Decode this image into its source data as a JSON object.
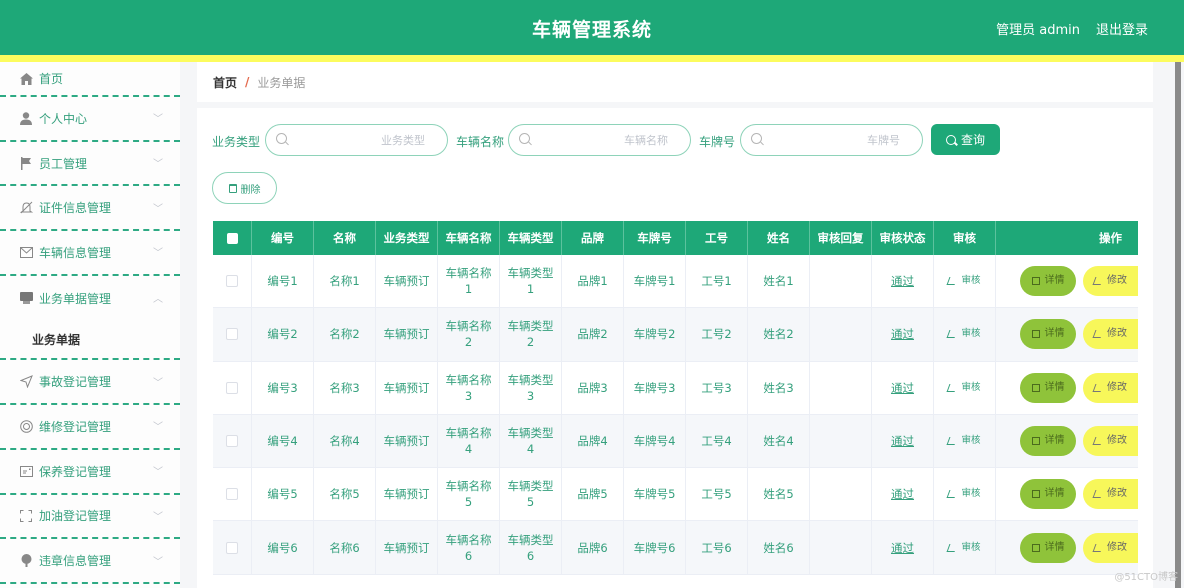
{
  "header": {
    "title": "车辆管理系统",
    "user": "管理员 admin",
    "logout": "退出登录"
  },
  "colors": {
    "primary": "#1ea878",
    "accent_stripe": "#fcfc5e",
    "detail_button": "#8fc33a",
    "edit_button": "#f7f75a",
    "text_green": "#35a07d"
  },
  "sidebar": {
    "items": [
      {
        "label": "首页",
        "icon": "home-icon"
      },
      {
        "label": "个人中心",
        "icon": "user-icon"
      },
      {
        "label": "员工管理",
        "icon": "flag-icon"
      },
      {
        "label": "证件信息管理",
        "icon": "bell-off-icon"
      },
      {
        "label": "车辆信息管理",
        "icon": "mail-icon"
      },
      {
        "label": "业务单据管理",
        "icon": "document-icon",
        "expanded": true,
        "children": [
          {
            "label": "业务单据"
          }
        ]
      },
      {
        "label": "事故登记管理",
        "icon": "navigation-icon"
      },
      {
        "label": "维修登记管理",
        "icon": "lifebuoy-icon"
      },
      {
        "label": "保养登记管理",
        "icon": "card-icon"
      },
      {
        "label": "加油登记管理",
        "icon": "fullscreen-icon"
      },
      {
        "label": "违章信息管理",
        "icon": "pin-icon"
      }
    ]
  },
  "breadcrumb": {
    "home": "首页",
    "separator": "/",
    "current": "业务单据"
  },
  "search": {
    "fields": [
      {
        "label": "业务类型",
        "placeholder": "业务类型",
        "value": ""
      },
      {
        "label": "车辆名称",
        "placeholder": "车辆名称",
        "value": ""
      },
      {
        "label": "车牌号",
        "placeholder": "车牌号",
        "value": ""
      }
    ],
    "query_button": "查询"
  },
  "actions": {
    "delete_button": "删除"
  },
  "table": {
    "columns": [
      "编号",
      "名称",
      "业务类型",
      "车辆名称",
      "车辆类型",
      "品牌",
      "车牌号",
      "工号",
      "姓名",
      "审核回复",
      "审核状态",
      "审核",
      "操作"
    ],
    "audit_label": "审核",
    "detail_label": "详情",
    "edit_label": "修改",
    "rows": [
      {
        "id": "编号1",
        "name": "名称1",
        "biz_type": "车辆预订",
        "car_name": "车辆名称\n1",
        "car_type": "车辆类型\n1",
        "brand": "品牌1",
        "plate": "车牌号1",
        "emp_no": "工号1",
        "person": "姓名1",
        "reply": "",
        "status": "通过"
      },
      {
        "id": "编号2",
        "name": "名称2",
        "biz_type": "车辆预订",
        "car_name": "车辆名称\n2",
        "car_type": "车辆类型\n2",
        "brand": "品牌2",
        "plate": "车牌号2",
        "emp_no": "工号2",
        "person": "姓名2",
        "reply": "",
        "status": "通过"
      },
      {
        "id": "编号3",
        "name": "名称3",
        "biz_type": "车辆预订",
        "car_name": "车辆名称\n3",
        "car_type": "车辆类型\n3",
        "brand": "品牌3",
        "plate": "车牌号3",
        "emp_no": "工号3",
        "person": "姓名3",
        "reply": "",
        "status": "通过"
      },
      {
        "id": "编号4",
        "name": "名称4",
        "biz_type": "车辆预订",
        "car_name": "车辆名称\n4",
        "car_type": "车辆类型\n4",
        "brand": "品牌4",
        "plate": "车牌号4",
        "emp_no": "工号4",
        "person": "姓名4",
        "reply": "",
        "status": "通过"
      },
      {
        "id": "编号5",
        "name": "名称5",
        "biz_type": "车辆预订",
        "car_name": "车辆名称\n5",
        "car_type": "车辆类型\n5",
        "brand": "品牌5",
        "plate": "车牌号5",
        "emp_no": "工号5",
        "person": "姓名5",
        "reply": "",
        "status": "通过"
      },
      {
        "id": "编号6",
        "name": "名称6",
        "biz_type": "车辆预订",
        "car_name": "车辆名称\n6",
        "car_type": "车辆类型\n6",
        "brand": "品牌6",
        "plate": "车牌号6",
        "emp_no": "工号6",
        "person": "姓名6",
        "reply": "",
        "status": "通过"
      }
    ]
  },
  "watermark": "@51CTO博客"
}
